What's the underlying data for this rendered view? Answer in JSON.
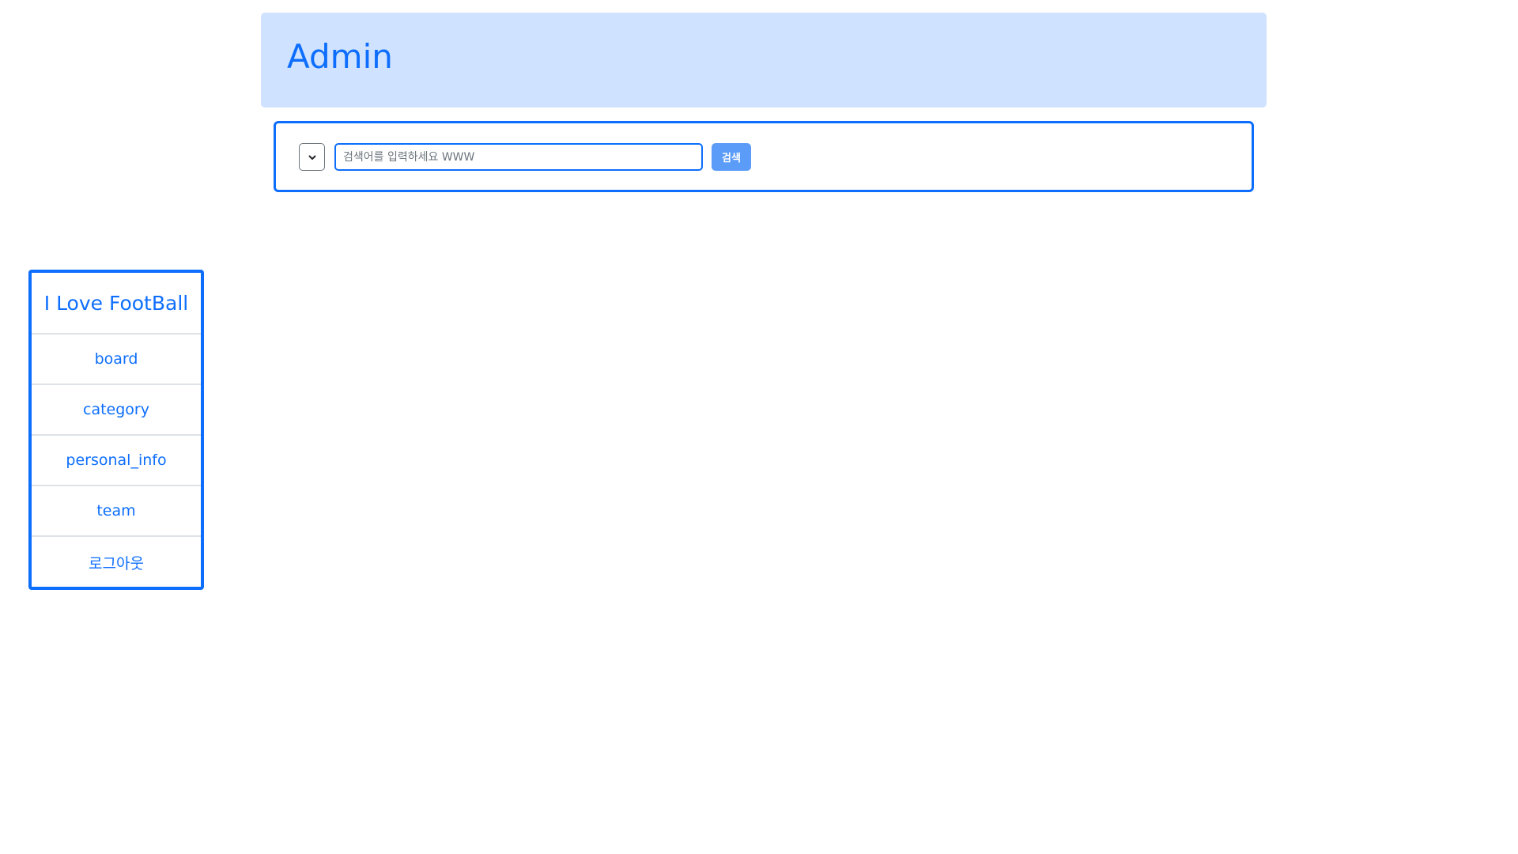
{
  "header": {
    "title": "Admin"
  },
  "search": {
    "select_value": "",
    "placeholder": "검색어를 입력하세요 WWW",
    "value": "",
    "button_label": "검색"
  },
  "sidebar": {
    "title": "I Love FootBall",
    "items": [
      {
        "label": "board"
      },
      {
        "label": "category"
      },
      {
        "label": "personal_info"
      },
      {
        "label": "team"
      },
      {
        "label": "로그아웃"
      }
    ]
  },
  "colors": {
    "accent": "#0d6efd",
    "header_bg": "#cfe2ff",
    "button_bg": "#5b9cf8"
  }
}
